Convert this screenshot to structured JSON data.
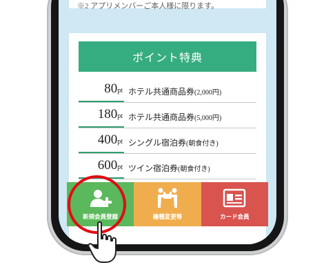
{
  "notice": {
    "text": "※2 アプリメンバーご本人様に限ります。"
  },
  "points": {
    "title": "ポイント特典",
    "rows": [
      {
        "value": "80",
        "unit": "pt",
        "label": "ホテル共通商品券",
        "sub": "(2,000円)"
      },
      {
        "value": "180",
        "unit": "pt",
        "label": "ホテル共通商品券",
        "sub": "(5,000円)"
      },
      {
        "value": "400",
        "unit": "pt",
        "label": "シングル宿泊券",
        "sub": "(朝食付き)"
      },
      {
        "value": "600",
        "unit": "pt",
        "label": "ツイン宿泊券",
        "sub": "(朝食付き)"
      }
    ]
  },
  "nav": {
    "items": [
      {
        "label": "新規会員登録",
        "icon": "add-user-icon",
        "color": "#5cb85c"
      },
      {
        "label": "機種変更等",
        "icon": "people-carry-icon",
        "color": "#f0ad4e"
      },
      {
        "label": "カード会員",
        "icon": "id-card-icon",
        "color": "#d9534f"
      }
    ]
  },
  "colors": {
    "accent_green": "#35ad80",
    "highlight_ring": "#e00c14",
    "screen_bg": "#cfe8f3"
  }
}
